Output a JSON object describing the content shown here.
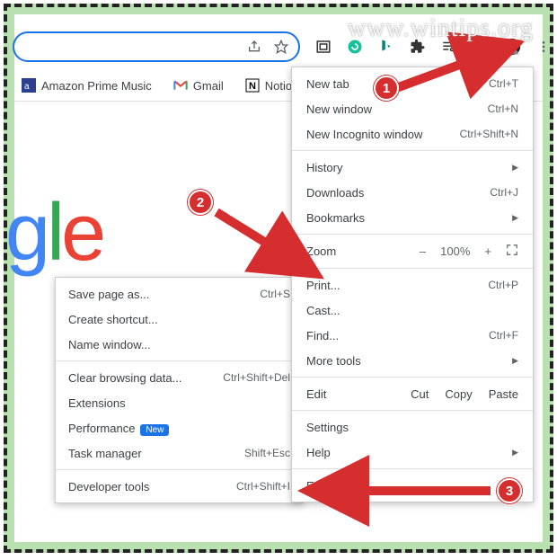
{
  "watermark": "www.wintips.org",
  "bookmarks": {
    "amazon": "Amazon Prime Music",
    "gmail": "Gmail",
    "notion": "Notion"
  },
  "logo_fragment": {
    "g": "g",
    "l": "l",
    "e": "e"
  },
  "menu": {
    "new_tab": "New tab",
    "new_tab_sc": "Ctrl+T",
    "new_window": "New window",
    "new_window_sc": "Ctrl+N",
    "new_incognito": "New Incognito window",
    "new_incognito_sc": "Ctrl+Shift+N",
    "history": "History",
    "downloads": "Downloads",
    "downloads_sc": "Ctrl+J",
    "bookmarks": "Bookmarks",
    "zoom": "Zoom",
    "zoom_minus": "–",
    "zoom_val": "100%",
    "zoom_plus": "+",
    "print": "Print...",
    "print_sc": "Ctrl+P",
    "cast": "Cast...",
    "find": "Find...",
    "find_sc": "Ctrl+F",
    "more_tools": "More tools",
    "edit": "Edit",
    "cut": "Cut",
    "copy": "Copy",
    "paste": "Paste",
    "settings": "Settings",
    "help": "Help",
    "exit": "Exit"
  },
  "submenu": {
    "save_page": "Save page as...",
    "save_page_sc": "Ctrl+S",
    "create_shortcut": "Create shortcut...",
    "name_window": "Name window...",
    "clear_browsing": "Clear browsing data...",
    "clear_browsing_sc": "Ctrl+Shift+Del",
    "extensions": "Extensions",
    "performance": "Performance",
    "perf_badge": "New",
    "task_manager": "Task manager",
    "task_manager_sc": "Shift+Esc",
    "dev_tools": "Developer tools",
    "dev_tools_sc": "Ctrl+Shift+I"
  },
  "callouts": {
    "c1": "1",
    "c2": "2",
    "c3": "3"
  }
}
